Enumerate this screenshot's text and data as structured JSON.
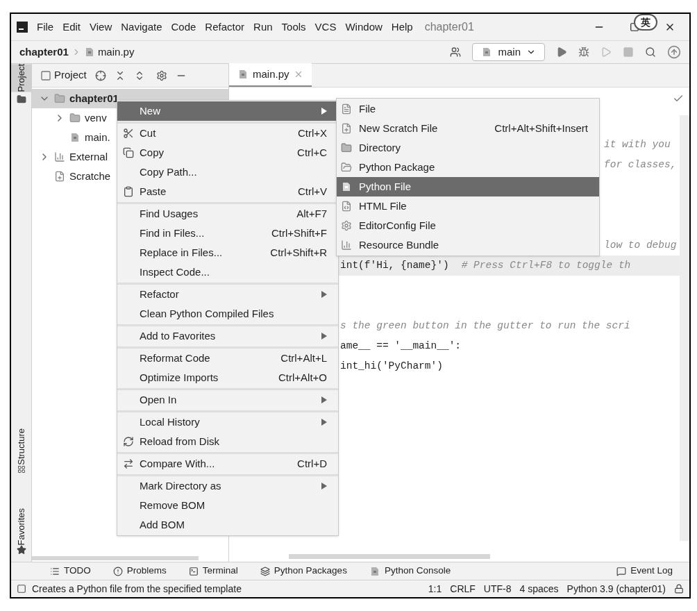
{
  "window": {
    "menu": [
      "File",
      "Edit",
      "View",
      "Navigate",
      "Code",
      "Refactor",
      "Run",
      "Tools",
      "VCS",
      "Window",
      "Help"
    ],
    "title": "chapter01",
    "ime_badge": "英"
  },
  "nav_bar": {
    "breadcrumbs": [
      "chapter01",
      "main.py"
    ],
    "run_config": "main"
  },
  "left_stripe": [
    {
      "label": "Project",
      "selected": true
    },
    {
      "label": "Structure",
      "selected": false
    },
    {
      "label": "Favorites",
      "selected": false
    }
  ],
  "project_panel": {
    "title": "Project",
    "tree": [
      {
        "label": "chapter01",
        "expanded": true,
        "selected": true,
        "kind": "folder",
        "children": [
          {
            "label": "venv",
            "expanded": false,
            "selected": false,
            "kind": "folder"
          },
          {
            "label": "main.",
            "selected": false,
            "kind": "python"
          }
        ]
      },
      {
        "label": "External",
        "expanded": false,
        "selected": false,
        "kind": "library"
      },
      {
        "label": "Scratche",
        "selected": false,
        "kind": "scratch"
      }
    ]
  },
  "editor": {
    "tab": "main.py",
    "lines": [
      {
        "kind": "blank"
      },
      {
        "kind": "blank"
      },
      {
        "kind": "right",
        "comment": "it with you"
      },
      {
        "kind": "right",
        "comment": "for classes,"
      },
      {
        "kind": "blank"
      },
      {
        "kind": "blank"
      },
      {
        "kind": "blank"
      },
      {
        "kind": "right",
        "comment": "low to debug"
      },
      {
        "kind": "left",
        "code": "int(f'Hi, {name}')",
        "comment": "# Press Ctrl+F8 to toggle th",
        "current": true
      },
      {
        "kind": "blank"
      },
      {
        "kind": "blank"
      },
      {
        "kind": "left",
        "comment": "s the green button in the gutter to run the scri"
      },
      {
        "kind": "left",
        "code": "ame__ == '__main__':"
      },
      {
        "kind": "left",
        "code": "int_hi('PyCharm')"
      }
    ]
  },
  "context_menu": {
    "sections": [
      [
        {
          "label": "New",
          "submenu": true,
          "selected": true
        }
      ],
      [
        {
          "label": "Cut",
          "shortcut": "Ctrl+X",
          "selected": false
        },
        {
          "label": "Copy",
          "shortcut": "Ctrl+C",
          "selected": false
        },
        {
          "label": "Copy Path...",
          "selected": false
        },
        {
          "label": "Paste",
          "shortcut": "Ctrl+V",
          "selected": false
        }
      ],
      [
        {
          "label": "Find Usages",
          "shortcut": "Alt+F7",
          "selected": false
        },
        {
          "label": "Find in Files...",
          "shortcut": "Ctrl+Shift+F",
          "selected": false
        },
        {
          "label": "Replace in Files...",
          "shortcut": "Ctrl+Shift+R",
          "selected": false
        },
        {
          "label": "Inspect Code...",
          "selected": false
        }
      ],
      [
        {
          "label": "Refactor",
          "submenu": true,
          "selected": false
        },
        {
          "label": "Clean Python Compiled Files",
          "selected": false
        }
      ],
      [
        {
          "label": "Add to Favorites",
          "submenu": true,
          "selected": false
        }
      ],
      [
        {
          "label": "Reformat Code",
          "shortcut": "Ctrl+Alt+L",
          "selected": false
        },
        {
          "label": "Optimize Imports",
          "shortcut": "Ctrl+Alt+O",
          "selected": false
        }
      ],
      [
        {
          "label": "Open In",
          "submenu": true,
          "selected": false
        }
      ],
      [
        {
          "label": "Local History",
          "submenu": true,
          "selected": false
        },
        {
          "label": "Reload from Disk",
          "selected": false
        }
      ],
      [
        {
          "label": "Compare With...",
          "shortcut": "Ctrl+D",
          "selected": false
        }
      ],
      [
        {
          "label": "Mark Directory as",
          "submenu": true,
          "selected": false
        },
        {
          "label": "Remove BOM",
          "selected": false
        },
        {
          "label": "Add BOM",
          "selected": false
        }
      ]
    ]
  },
  "new_submenu": [
    {
      "label": "File",
      "selected": false
    },
    {
      "label": "New Scratch File",
      "shortcut": "Ctrl+Alt+Shift+Insert",
      "selected": false
    },
    {
      "label": "Directory",
      "selected": false
    },
    {
      "label": "Python Package",
      "selected": false
    },
    {
      "label": "Python File",
      "selected": true
    },
    {
      "label": "HTML File",
      "selected": false
    },
    {
      "label": "EditorConfig File",
      "selected": false
    },
    {
      "label": "Resource Bundle",
      "selected": false
    }
  ],
  "tool_windows": [
    {
      "label": "TODO"
    },
    {
      "label": "Problems"
    },
    {
      "label": "Terminal"
    },
    {
      "label": "Python Packages"
    },
    {
      "label": "Python Console"
    }
  ],
  "event_log": "Event Log",
  "status_bar": {
    "message": "Creates a Python file from the specified template",
    "items": [
      "1:1",
      "CRLF",
      "UTF-8",
      "4 spaces",
      "Python 3.9 (chapter01)"
    ]
  }
}
